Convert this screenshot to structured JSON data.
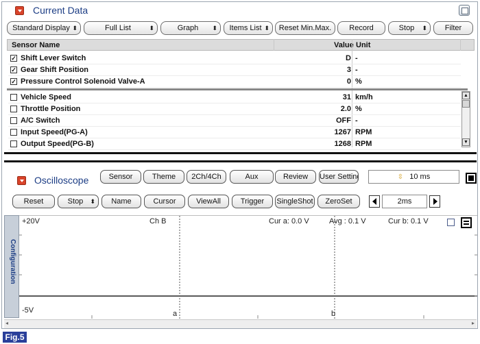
{
  "current_data": {
    "title": "Current Data",
    "toolbar": [
      {
        "label": "Standard Display",
        "dropdown": true
      },
      {
        "label": "Full List",
        "dropdown": true
      },
      {
        "label": "Graph",
        "dropdown": true
      },
      {
        "label": "Items List",
        "dropdown": true
      },
      {
        "label": "Reset Min.Max.",
        "dropdown": false
      },
      {
        "label": "Record",
        "dropdown": false
      },
      {
        "label": "Stop",
        "dropdown": true
      },
      {
        "label": "Filter",
        "dropdown": false
      }
    ],
    "columns": {
      "name": "Sensor Name",
      "value": "Value",
      "unit": "Unit"
    },
    "fixed_rows": [
      {
        "checked": true,
        "name": "Shift Lever Switch",
        "value": "D",
        "unit": "-"
      },
      {
        "checked": true,
        "name": "Gear Shift Position",
        "value": "3",
        "unit": "-"
      },
      {
        "checked": true,
        "name": "Pressure Control Solenoid Valve-A",
        "value": "0",
        "unit": "%"
      }
    ],
    "rows": [
      {
        "checked": false,
        "name": "Vehicle Speed",
        "value": "31",
        "unit": "km/h"
      },
      {
        "checked": false,
        "name": "Throttle Position",
        "value": "2.0",
        "unit": "%"
      },
      {
        "checked": false,
        "name": "A/C Switch",
        "value": "OFF",
        "unit": "-"
      },
      {
        "checked": false,
        "name": "Input Speed(PG-A)",
        "value": "1267",
        "unit": "RPM"
      },
      {
        "checked": false,
        "name": "Output Speed(PG-B)",
        "value": "1268",
        "unit": "RPM"
      }
    ]
  },
  "oscilloscope": {
    "title": "Oscilloscope",
    "row1_buttons": [
      "Sensor",
      "Theme",
      "2Ch/4Ch",
      "Aux",
      "Review",
      "User Setting"
    ],
    "time_div": "10 ms",
    "row2_buttons": [
      {
        "label": "Reset",
        "dropdown": false
      },
      {
        "label": "Stop",
        "dropdown": true
      },
      {
        "label": "Name",
        "dropdown": false
      },
      {
        "label": "Cursor",
        "dropdown": false
      },
      {
        "label": "ViewAll",
        "dropdown": false
      },
      {
        "label": "Trigger",
        "dropdown": false
      },
      {
        "label": "SingleShot",
        "dropdown": false
      },
      {
        "label": "ZeroSet",
        "dropdown": false
      }
    ],
    "step_value": "2ms",
    "config_tab": "Configuration",
    "plot": {
      "top_label": "+20V",
      "bottom_label": "-5V",
      "channel": "Ch B",
      "cur_a": "Cur a: 0.0 V",
      "avg": "Avg : 0.1 V",
      "cur_b": "Cur b: 0.1 V",
      "cursor_a": "a",
      "cursor_b": "b"
    }
  },
  "figure_label": "Fig.5"
}
